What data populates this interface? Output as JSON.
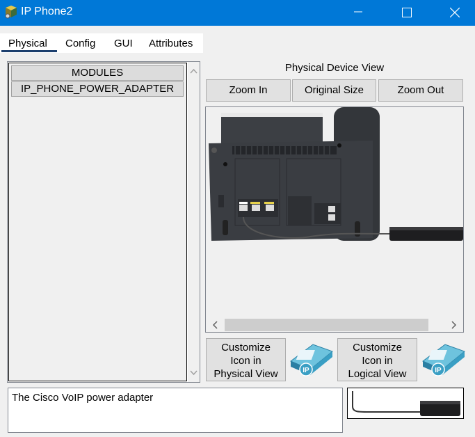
{
  "window": {
    "title": "IP Phone2"
  },
  "tabs": [
    {
      "label": "Physical",
      "active": true
    },
    {
      "label": "Config"
    },
    {
      "label": "GUI"
    },
    {
      "label": "Attributes"
    }
  ],
  "modules": {
    "header": "MODULES",
    "items": [
      "IP_PHONE_POWER_ADAPTER"
    ]
  },
  "device_view": {
    "title": "Physical Device View",
    "zoom_in": "Zoom In",
    "original_size": "Original Size",
    "zoom_out": "Zoom Out"
  },
  "customize": {
    "physical_label": [
      "Customize",
      "Icon in",
      "Physical View"
    ],
    "logical_label": [
      "Customize",
      "Icon in",
      "Logical View"
    ],
    "icon_text": "IP"
  },
  "description": "The Cisco VoIP power adapter",
  "colors": {
    "titlebar": "#0078d7",
    "tab_underline": "#1c3f6e",
    "icon_teal": "#3a9fc4"
  }
}
